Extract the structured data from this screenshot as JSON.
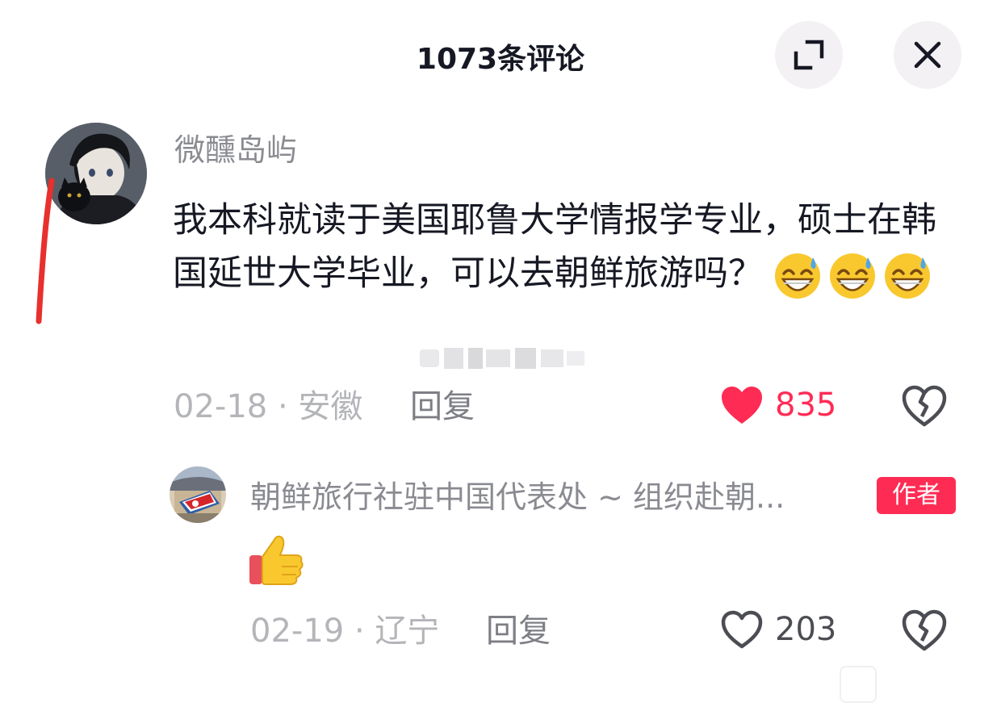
{
  "header": {
    "title": "1073条评论",
    "expand_icon": "expand-icon",
    "close_icon": "close-icon"
  },
  "comments": [
    {
      "username": "微醺岛屿",
      "text": "我本科就读于美国耶鲁大学情报学专业，硕士在韩国延世大学毕业，可以去朝鲜旅游吗？",
      "emojis": [
        "grinning-sweat-emoji",
        "grinning-sweat-emoji",
        "grinning-sweat-emoji"
      ],
      "date_location": "02-18 · 安徽",
      "reply_label": "回复",
      "likes": "835",
      "liked": true,
      "reply": {
        "username": "朝鲜旅行社驻中国代表处 ~ 组织赴朝...",
        "badge": "作者",
        "emoji": "thumbs-up-emoji",
        "date_location": "02-19 · 辽宁",
        "reply_label": "回复",
        "likes": "203",
        "liked": false
      }
    }
  ],
  "colors": {
    "accent": "#fe2c55",
    "muted_text": "#8a8b91",
    "meta_text": "#b4b5b9",
    "annotation_red": "#e8302e"
  }
}
